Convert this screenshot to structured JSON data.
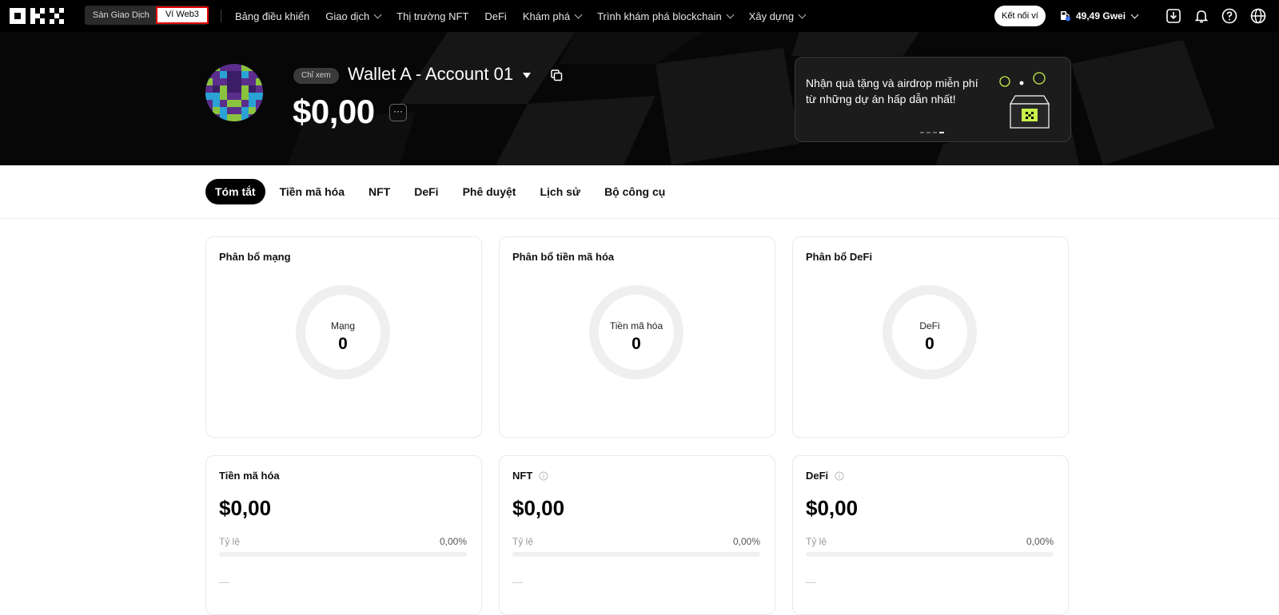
{
  "nav": {
    "switch": {
      "exchange": "Sàn Giao Dịch",
      "web3": "Ví Web3"
    },
    "menu": [
      {
        "label": "Bảng điều khiển",
        "dropdown": false
      },
      {
        "label": "Giao dịch",
        "dropdown": true
      },
      {
        "label": "Thị trường NFT",
        "dropdown": false
      },
      {
        "label": "DeFi",
        "dropdown": false
      },
      {
        "label": "Khám phá",
        "dropdown": true
      },
      {
        "label": "Trình khám phá blockchain",
        "dropdown": true
      },
      {
        "label": "Xây dựng",
        "dropdown": true
      }
    ],
    "connect_wallet": "Kết nối ví",
    "gas": "49,49 Gwei",
    "icons": [
      "download-icon",
      "bell-icon",
      "help-icon",
      "globe-icon"
    ]
  },
  "hero": {
    "view_only": "Chỉ xem",
    "wallet_name": "Wallet A - Account 01",
    "balance": "$0,00",
    "more": "···",
    "promo_text": "Nhận quà tặng và airdrop miễn phí từ những dự án hấp dẫn nhất!",
    "promo_pages": 4,
    "promo_active_page": 4
  },
  "tabs": [
    "Tóm tắt",
    "Tiền mã hóa",
    "NFT",
    "DeFi",
    "Phê duyệt",
    "Lịch sử",
    "Bộ công cụ"
  ],
  "distribution": [
    {
      "title": "Phân bổ mạng",
      "center_label": "Mạng",
      "center_value": "0"
    },
    {
      "title": "Phân bổ tiền mã hóa",
      "center_label": "Tiền mã hóa",
      "center_value": "0"
    },
    {
      "title": "Phân bổ DeFi",
      "center_label": "DeFi",
      "center_value": "0"
    }
  ],
  "assets": [
    {
      "title": "Tiền mã hóa",
      "info": false,
      "amount": "$0,00",
      "ratio_label": "Tỷ lệ",
      "ratio_value": "0,00%",
      "ratio": 0,
      "empty": "—"
    },
    {
      "title": "NFT",
      "info": true,
      "amount": "$0,00",
      "ratio_label": "Tỷ lệ",
      "ratio_value": "0,00%",
      "ratio": 0,
      "empty": "—"
    },
    {
      "title": "DeFi",
      "info": true,
      "amount": "$0,00",
      "ratio_label": "Tỷ lệ",
      "ratio_value": "0,00%",
      "ratio": 0,
      "empty": "—"
    }
  ],
  "colors": {
    "accent": "#000000",
    "highlight_border": "#e00000",
    "avatar": [
      "#5b2e8c",
      "#8ac43f",
      "#2aa3d4",
      "#3a1d66"
    ]
  }
}
